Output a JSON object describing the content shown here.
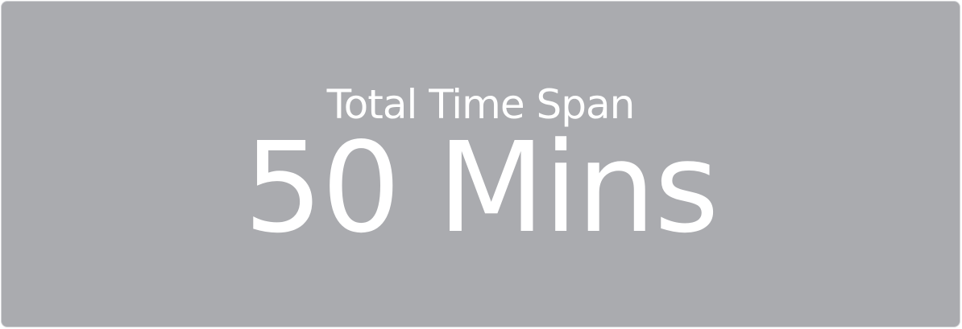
{
  "metric_card": {
    "label": "Total Time Span",
    "value": "50 Mins"
  },
  "colors": {
    "card_background": "#aaabaf",
    "text": "#ffffff"
  }
}
